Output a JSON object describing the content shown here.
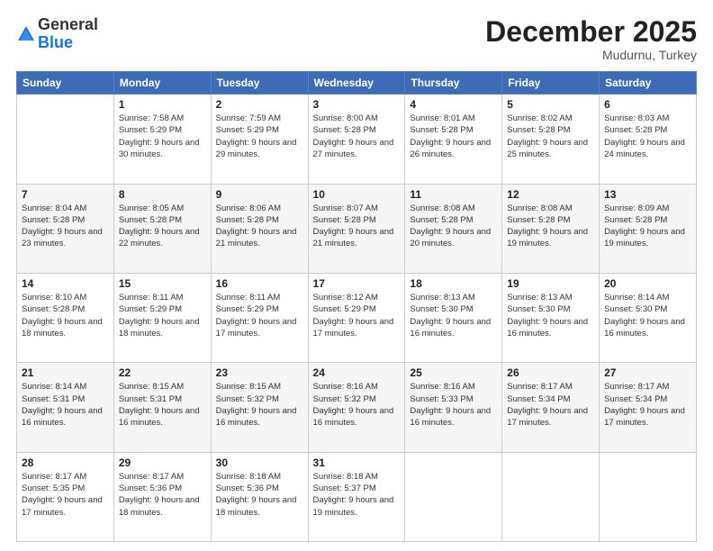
{
  "header": {
    "logo_general": "General",
    "logo_blue": "Blue",
    "month_title": "December 2025",
    "location": "Mudurnu, Turkey"
  },
  "weekdays": [
    "Sunday",
    "Monday",
    "Tuesday",
    "Wednesday",
    "Thursday",
    "Friday",
    "Saturday"
  ],
  "weeks": [
    [
      {
        "day": "",
        "sunrise": "",
        "sunset": "",
        "daylight": ""
      },
      {
        "day": "1",
        "sunrise": "Sunrise: 7:58 AM",
        "sunset": "Sunset: 5:29 PM",
        "daylight": "Daylight: 9 hours and 30 minutes."
      },
      {
        "day": "2",
        "sunrise": "Sunrise: 7:59 AM",
        "sunset": "Sunset: 5:29 PM",
        "daylight": "Daylight: 9 hours and 29 minutes."
      },
      {
        "day": "3",
        "sunrise": "Sunrise: 8:00 AM",
        "sunset": "Sunset: 5:28 PM",
        "daylight": "Daylight: 9 hours and 27 minutes."
      },
      {
        "day": "4",
        "sunrise": "Sunrise: 8:01 AM",
        "sunset": "Sunset: 5:28 PM",
        "daylight": "Daylight: 9 hours and 26 minutes."
      },
      {
        "day": "5",
        "sunrise": "Sunrise: 8:02 AM",
        "sunset": "Sunset: 5:28 PM",
        "daylight": "Daylight: 9 hours and 25 minutes."
      },
      {
        "day": "6",
        "sunrise": "Sunrise: 8:03 AM",
        "sunset": "Sunset: 5:28 PM",
        "daylight": "Daylight: 9 hours and 24 minutes."
      }
    ],
    [
      {
        "day": "7",
        "sunrise": "Sunrise: 8:04 AM",
        "sunset": "Sunset: 5:28 PM",
        "daylight": "Daylight: 9 hours and 23 minutes."
      },
      {
        "day": "8",
        "sunrise": "Sunrise: 8:05 AM",
        "sunset": "Sunset: 5:28 PM",
        "daylight": "Daylight: 9 hours and 22 minutes."
      },
      {
        "day": "9",
        "sunrise": "Sunrise: 8:06 AM",
        "sunset": "Sunset: 5:28 PM",
        "daylight": "Daylight: 9 hours and 21 minutes."
      },
      {
        "day": "10",
        "sunrise": "Sunrise: 8:07 AM",
        "sunset": "Sunset: 5:28 PM",
        "daylight": "Daylight: 9 hours and 21 minutes."
      },
      {
        "day": "11",
        "sunrise": "Sunrise: 8:08 AM",
        "sunset": "Sunset: 5:28 PM",
        "daylight": "Daylight: 9 hours and 20 minutes."
      },
      {
        "day": "12",
        "sunrise": "Sunrise: 8:08 AM",
        "sunset": "Sunset: 5:28 PM",
        "daylight": "Daylight: 9 hours and 19 minutes."
      },
      {
        "day": "13",
        "sunrise": "Sunrise: 8:09 AM",
        "sunset": "Sunset: 5:28 PM",
        "daylight": "Daylight: 9 hours and 19 minutes."
      }
    ],
    [
      {
        "day": "14",
        "sunrise": "Sunrise: 8:10 AM",
        "sunset": "Sunset: 5:28 PM",
        "daylight": "Daylight: 9 hours and 18 minutes."
      },
      {
        "day": "15",
        "sunrise": "Sunrise: 8:11 AM",
        "sunset": "Sunset: 5:29 PM",
        "daylight": "Daylight: 9 hours and 18 minutes."
      },
      {
        "day": "16",
        "sunrise": "Sunrise: 8:11 AM",
        "sunset": "Sunset: 5:29 PM",
        "daylight": "Daylight: 9 hours and 17 minutes."
      },
      {
        "day": "17",
        "sunrise": "Sunrise: 8:12 AM",
        "sunset": "Sunset: 5:29 PM",
        "daylight": "Daylight: 9 hours and 17 minutes."
      },
      {
        "day": "18",
        "sunrise": "Sunrise: 8:13 AM",
        "sunset": "Sunset: 5:30 PM",
        "daylight": "Daylight: 9 hours and 16 minutes."
      },
      {
        "day": "19",
        "sunrise": "Sunrise: 8:13 AM",
        "sunset": "Sunset: 5:30 PM",
        "daylight": "Daylight: 9 hours and 16 minutes."
      },
      {
        "day": "20",
        "sunrise": "Sunrise: 8:14 AM",
        "sunset": "Sunset: 5:30 PM",
        "daylight": "Daylight: 9 hours and 16 minutes."
      }
    ],
    [
      {
        "day": "21",
        "sunrise": "Sunrise: 8:14 AM",
        "sunset": "Sunset: 5:31 PM",
        "daylight": "Daylight: 9 hours and 16 minutes."
      },
      {
        "day": "22",
        "sunrise": "Sunrise: 8:15 AM",
        "sunset": "Sunset: 5:31 PM",
        "daylight": "Daylight: 9 hours and 16 minutes."
      },
      {
        "day": "23",
        "sunrise": "Sunrise: 8:15 AM",
        "sunset": "Sunset: 5:32 PM",
        "daylight": "Daylight: 9 hours and 16 minutes."
      },
      {
        "day": "24",
        "sunrise": "Sunrise: 8:16 AM",
        "sunset": "Sunset: 5:32 PM",
        "daylight": "Daylight: 9 hours and 16 minutes."
      },
      {
        "day": "25",
        "sunrise": "Sunrise: 8:16 AM",
        "sunset": "Sunset: 5:33 PM",
        "daylight": "Daylight: 9 hours and 16 minutes."
      },
      {
        "day": "26",
        "sunrise": "Sunrise: 8:17 AM",
        "sunset": "Sunset: 5:34 PM",
        "daylight": "Daylight: 9 hours and 17 minutes."
      },
      {
        "day": "27",
        "sunrise": "Sunrise: 8:17 AM",
        "sunset": "Sunset: 5:34 PM",
        "daylight": "Daylight: 9 hours and 17 minutes."
      }
    ],
    [
      {
        "day": "28",
        "sunrise": "Sunrise: 8:17 AM",
        "sunset": "Sunset: 5:35 PM",
        "daylight": "Daylight: 9 hours and 17 minutes."
      },
      {
        "day": "29",
        "sunrise": "Sunrise: 8:17 AM",
        "sunset": "Sunset: 5:36 PM",
        "daylight": "Daylight: 9 hours and 18 minutes."
      },
      {
        "day": "30",
        "sunrise": "Sunrise: 8:18 AM",
        "sunset": "Sunset: 5:36 PM",
        "daylight": "Daylight: 9 hours and 18 minutes."
      },
      {
        "day": "31",
        "sunrise": "Sunrise: 8:18 AM",
        "sunset": "Sunset: 5:37 PM",
        "daylight": "Daylight: 9 hours and 19 minutes."
      },
      {
        "day": "",
        "sunrise": "",
        "sunset": "",
        "daylight": ""
      },
      {
        "day": "",
        "sunrise": "",
        "sunset": "",
        "daylight": ""
      },
      {
        "day": "",
        "sunrise": "",
        "sunset": "",
        "daylight": ""
      }
    ]
  ]
}
